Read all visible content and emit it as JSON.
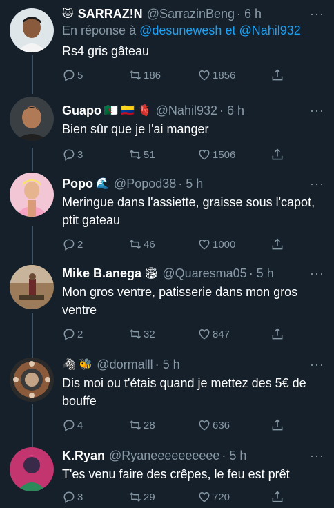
{
  "tweets": [
    {
      "name": "SARRAZ!N",
      "name_prefix": "🐱",
      "emoji": "",
      "handle": "@SarrazinBeng",
      "time": "· 6 h",
      "reply_label": "En réponse à",
      "reply_users": "@desunewesh et @Nahil932",
      "text": "Rs4 gris gâteau",
      "replies": "5",
      "retweets": "186",
      "likes": "1856"
    },
    {
      "name": "Guapo",
      "name_prefix": "",
      "emoji": "🇩🇿 🇨🇴 🫀",
      "handle": "@Nahil932",
      "time": "· 6 h",
      "text": "Bien sûr que je l'ai manger",
      "replies": "3",
      "retweets": "51",
      "likes": "1506"
    },
    {
      "name": "Popo",
      "name_prefix": "",
      "emoji": "🌊",
      "handle": "@Popod38",
      "time": "· 5 h",
      "text": "Meringue dans l'assiette, graisse sous l'capot, ptit gateau",
      "replies": "2",
      "retweets": "46",
      "likes": "1000"
    },
    {
      "name": "Mike B.anega",
      "name_prefix": "",
      "emoji": "🏟",
      "handle": "@Quaresma05",
      "time": "· 5 h",
      "text": "Mon gros ventre, patisserie dans mon gros ventre",
      "replies": "2",
      "retweets": "32",
      "likes": "847"
    },
    {
      "name": "",
      "name_prefix": "",
      "emoji": "🦓 🐝",
      "handle": "@dormalll",
      "time": "· 5 h",
      "text": "Dis moi ou t'étais quand je mettez des 5€ de bouffe",
      "replies": "4",
      "retweets": "28",
      "likes": "636"
    },
    {
      "name": "K.Ryan",
      "name_prefix": "",
      "emoji": "",
      "handle": "@Ryaneeeeeeeeee",
      "time": "· 5 h",
      "text": "T'es venu faire des crêpes, le feu est prêt",
      "replies": "3",
      "retweets": "29",
      "likes": "720"
    }
  ],
  "icons": {
    "reply": "reply-icon",
    "retweet": "retweet-icon",
    "like": "heart-icon",
    "share": "share-icon",
    "more": "more-icon"
  },
  "colors": {
    "background": "#15202b",
    "secondary_text": "#8899a6",
    "link": "#1da1f2",
    "thread_line": "#3d5466"
  }
}
